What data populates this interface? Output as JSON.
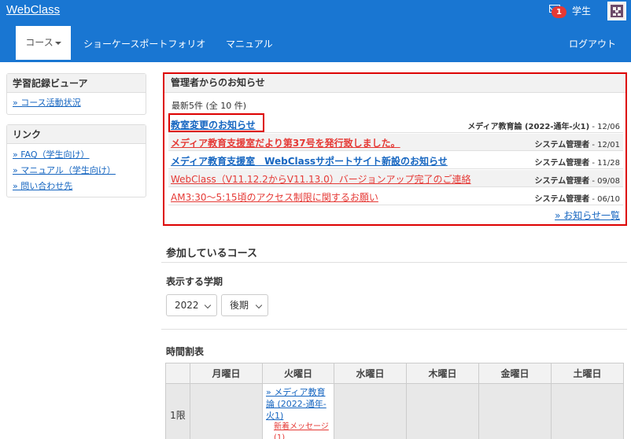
{
  "header": {
    "brand": "WebClass",
    "mail_count": "1",
    "user_label": "学生"
  },
  "nav": {
    "course_label": "コース",
    "showcase_label": "ショーケースポートフォリオ",
    "manual_label": "マニュアル",
    "logout_label": "ログアウト"
  },
  "sidebar": {
    "viewer": {
      "title": "学習記録ビューア",
      "links": [
        "» コース活動状況"
      ]
    },
    "links_panel": {
      "title": "リンク",
      "links": [
        "» FAQ（学生向け）",
        "» マニュアル（学生向け）",
        "» 問い合わせ先"
      ]
    }
  },
  "news": {
    "title": "管理者からのお知らせ",
    "count_text": "最新5件 (全 10 件)",
    "items": [
      {
        "title": "教室変更のお知らせ",
        "source": "メディア教育論 (2022-通年-火1)",
        "date": " - 12/06"
      },
      {
        "title": "メディア教育支援室だより第37号を発行致しました。",
        "source": "システム管理者",
        "date": " - 12/01"
      },
      {
        "title": "メディア教育支援室　WebClassサポートサイト新設のお知らせ",
        "source": "システム管理者",
        "date": " - 11/28"
      },
      {
        "title": "WebClass（V11.12.2からV11.13.0）バージョンアップ完了のご連絡",
        "source": "システム管理者",
        "date": " - 09/08"
      },
      {
        "title": "AM3:30～5:15頃のアクセス制限に関するお願い",
        "source": "システム管理者",
        "date": " - 06/10"
      }
    ],
    "more_link": "» お知らせ一覧"
  },
  "courses": {
    "title": "参加しているコース",
    "term_label": "表示する学期",
    "year_value": "2022",
    "term_value": "後期"
  },
  "timetable": {
    "title": "時間割表",
    "days": [
      "月曜日",
      "火曜日",
      "水曜日",
      "木曜日",
      "金曜日",
      "土曜日"
    ],
    "period_1": "1限",
    "course_1": "» メディア教育論 (2022-通年-火1)",
    "course_1_msg": "新着メッセージ(1)"
  },
  "colors": {
    "brand_blue": "#1976d2",
    "link_blue": "#1565c0",
    "alert_red": "#e53935",
    "highlight_red": "#dd0000"
  }
}
